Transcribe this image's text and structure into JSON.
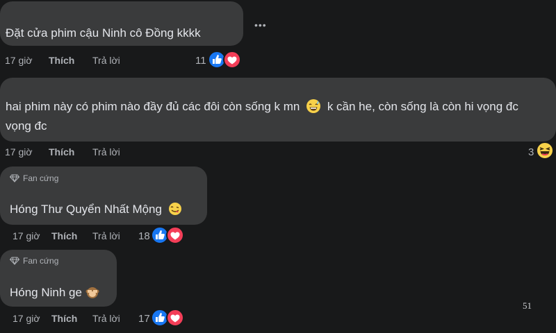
{
  "comments": [
    {
      "text": "Đặt cửa phim cậu Ninh cô Đồng kkkk",
      "time": "17 giờ",
      "like_label": "Thích",
      "reply_label": "Trả lời",
      "reaction_count": "11",
      "reactions": [
        "like-icon",
        "love-icon"
      ],
      "more": "•••"
    },
    {
      "text": "hai phim này có phim nào đầy đủ các đôi còn sống k mn",
      "text_after_emoji": "k cần he, còn sống là còn hi vọng đc",
      "inline_emoji": "grinning-sweat-emoji",
      "time": "17 giờ",
      "like_label": "Thích",
      "reply_label": "Trả lời",
      "reaction_count": "3",
      "reactions": [
        "haha-icon"
      ]
    },
    {
      "badge": "Fan cứng",
      "badge_icon": "diamond-icon",
      "text": "Hóng Thư Quyển Nhất Mộng",
      "inline_emoji": "yum-emoji",
      "time": "17 giờ",
      "like_label": "Thích",
      "reply_label": "Trả lời",
      "reaction_count": "18",
      "reactions": [
        "like-icon",
        "love-icon"
      ]
    },
    {
      "badge": "Fan cứng",
      "badge_icon": "diamond-icon",
      "text": "Hóng Ninh ge",
      "inline_emoji": "see-no-evil-monkey-emoji",
      "time": "17 giờ",
      "like_label": "Thích",
      "reply_label": "Trả lời",
      "reaction_count": "17",
      "reactions": [
        "like-icon",
        "love-icon"
      ]
    }
  ],
  "page_number": "51",
  "colors": {
    "background": "#18191a",
    "bubble": "#3a3b3c",
    "text": "#e4e6eb",
    "secondary": "#b0b3b8",
    "like_blue": "#1877f2",
    "love_red": "#f33e58",
    "emoji_yellow": "#f7d14a"
  }
}
